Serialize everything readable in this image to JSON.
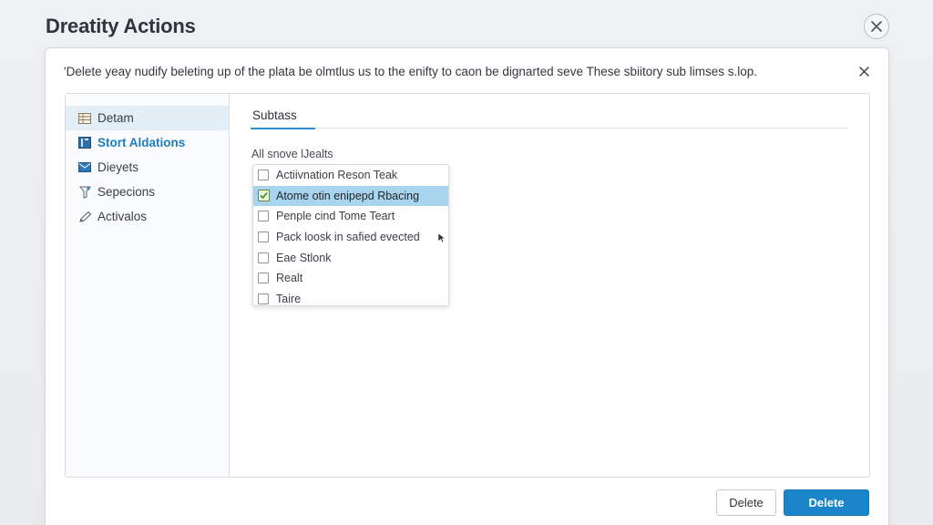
{
  "app": {
    "title": "Dreatity Actions"
  },
  "dialog": {
    "message": "'Delete yeay nudify beleting up of the plata be olmtlus us to the enifty to caon be dignarted seve These sbiitory sub limses s.lop."
  },
  "sidebar": {
    "items": [
      {
        "label": "Detam",
        "icon": "table-icon"
      },
      {
        "label": "Stort Aldations",
        "icon": "book-icon",
        "active": true
      },
      {
        "label": "Dieyets",
        "icon": "mail-icon"
      },
      {
        "label": "Sepecions",
        "icon": "filter-icon"
      },
      {
        "label": "Activalos",
        "icon": "pencil-icon"
      }
    ]
  },
  "main": {
    "tab_label": "Subtass",
    "section_label": "All snove lJealts",
    "list_items": [
      {
        "label": "Actiivnation Reson Teak",
        "checked": false
      },
      {
        "label": "Atome otin enipepd Rbacing",
        "checked": true
      },
      {
        "label": "Penple cind Tome Teart",
        "checked": false
      },
      {
        "label": "Pack loosk in safied evected",
        "checked": false
      },
      {
        "label": "Eae Stlonk",
        "checked": false
      },
      {
        "label": "Realt",
        "checked": false
      },
      {
        "label": "Taire",
        "checked": false
      }
    ]
  },
  "buttons": {
    "secondary_label": "Delete",
    "primary_label": "Delete"
  },
  "colors": {
    "accent": "#1a86c9",
    "selected_row": "#a9d4ee",
    "sidebar_hover": "#e3eef6"
  }
}
